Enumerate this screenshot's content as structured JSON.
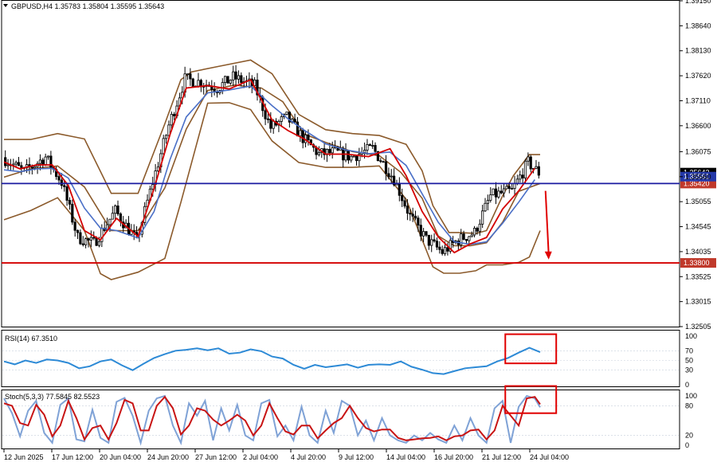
{
  "colors": {
    "background": "#ffffff",
    "grid": "#c8d0dc",
    "candle": "#000000",
    "bb": "#8b5a2b",
    "ema_fast": "#d40000",
    "ema_slow": "#4a6fc7",
    "support": "#d40000",
    "resistance": "#1a1aa0",
    "level_label_bg": "#c0392b",
    "rsi": "#2d8ad6",
    "stoch_main": "#7fa2d6",
    "stoch_signal": "#c81414",
    "highlight_box": "#e00000",
    "arrow": "#e00000"
  },
  "chart_data": [
    {
      "type": "line",
      "role": "main-price-panel",
      "title": "GBPUSD,H4  1.35783 1.35804 1.35595 1.35643",
      "ylim": [
        1.325,
        1.3915
      ],
      "y_ticks": [
        1.3915,
        1.3864,
        1.3813,
        1.3762,
        1.3711,
        1.366,
        1.3607,
        1.3556,
        1.3505,
        1.3454,
        1.3403,
        1.3352,
        1.3301,
        1.325
      ],
      "y_tick_labels": [
        "1.39150",
        "1.38640",
        "1.38130",
        "1.37620",
        "1.37110",
        "1.36600",
        "1.36075",
        "1.35560",
        "1.35055",
        "1.34545",
        "1.34035",
        "1.33525",
        "1.33015",
        "1.32505"
      ],
      "x_labels": [
        "12 Jun 2025",
        "17 Jun 12:00",
        "20 Jun 04:00",
        "24 Jun 20:00",
        "27 Jun 12:00",
        "2 Jul 04:00",
        "4 Jul 20:00",
        "9 Jul 12:00",
        "14 Jul 04:00",
        "16 Jul 20:00",
        "21 Jul 12:00",
        "24 Jul 04:00"
      ],
      "bar_count": 200,
      "series": [
        {
          "name": "Close",
          "x": [
            0,
            8,
            16,
            22,
            28,
            34,
            42,
            50,
            56,
            62,
            68,
            74,
            80,
            86,
            94,
            100,
            106,
            112,
            118,
            124,
            130,
            138,
            146,
            152,
            158,
            164,
            170,
            176,
            182,
            190,
            196,
            200
          ],
          "y": [
            1.3595,
            1.3566,
            1.3596,
            1.3545,
            1.3432,
            1.342,
            1.3486,
            1.3425,
            1.3545,
            1.3661,
            1.3755,
            1.3749,
            1.3737,
            1.3759,
            1.3741,
            1.3656,
            1.3677,
            1.3635,
            1.3602,
            1.3606,
            1.3596,
            1.3614,
            1.3552,
            1.3475,
            1.3428,
            1.3402,
            1.3427,
            1.3442,
            1.3517,
            1.3527,
            1.3585,
            1.3564
          ]
        },
        {
          "name": "Bollinger Upper",
          "x": [
            0,
            10,
            20,
            30,
            40,
            50,
            60,
            66,
            70,
            80,
            92,
            100,
            110,
            120,
            130,
            140,
            150,
            156,
            160,
            166,
            170,
            176,
            180,
            186,
            190,
            196,
            200
          ],
          "y": [
            1.3632,
            1.3632,
            1.3644,
            1.3633,
            1.3522,
            1.3522,
            1.3664,
            1.3754,
            1.377,
            1.3781,
            1.3794,
            1.3766,
            1.3683,
            1.3652,
            1.3644,
            1.364,
            1.3622,
            1.3568,
            1.3497,
            1.3442,
            1.3442,
            1.344,
            1.3446,
            1.3517,
            1.3558,
            1.3601,
            1.3601
          ]
        },
        {
          "name": "Bollinger Middle",
          "x": [
            0,
            10,
            20,
            30,
            40,
            50,
            60,
            68,
            76,
            86,
            96,
            104,
            112,
            120,
            130,
            140,
            148,
            156,
            162,
            168,
            174,
            180,
            186,
            192,
            200
          ],
          "y": [
            1.3555,
            1.3572,
            1.3578,
            1.3535,
            1.3446,
            1.3446,
            1.3533,
            1.3653,
            1.3732,
            1.3743,
            1.3737,
            1.3709,
            1.3643,
            1.3626,
            1.3607,
            1.3599,
            1.3565,
            1.3512,
            1.3435,
            1.3415,
            1.3415,
            1.3421,
            1.3463,
            1.3526,
            1.3542
          ]
        },
        {
          "name": "Bollinger Lower",
          "x": [
            0,
            10,
            20,
            30,
            36,
            40,
            50,
            60,
            66,
            76,
            84,
            92,
            100,
            110,
            120,
            130,
            140,
            150,
            160,
            164,
            170,
            176,
            180,
            186,
            192,
            196,
            200
          ],
          "y": [
            1.3468,
            1.3487,
            1.3513,
            1.3446,
            1.3358,
            1.3346,
            1.3361,
            1.3389,
            1.3504,
            1.3706,
            1.3707,
            1.3693,
            1.3629,
            1.3585,
            1.3575,
            1.3575,
            1.3578,
            1.351,
            1.3372,
            1.3359,
            1.3359,
            1.3364,
            1.3376,
            1.3376,
            1.3381,
            1.3392,
            1.3446
          ]
        },
        {
          "name": "EMA fast",
          "x": [
            0,
            6,
            12,
            18,
            24,
            30,
            36,
            42,
            50,
            56,
            62,
            68,
            76,
            84,
            92,
            100,
            106,
            112,
            120,
            128,
            136,
            144,
            150,
            156,
            162,
            168,
            174,
            180,
            186,
            192,
            198
          ],
          "y": [
            1.3586,
            1.3572,
            1.358,
            1.358,
            1.3538,
            1.3446,
            1.3427,
            1.3471,
            1.3434,
            1.3532,
            1.3643,
            1.3737,
            1.3742,
            1.3735,
            1.3754,
            1.3672,
            1.365,
            1.3633,
            1.3602,
            1.3602,
            1.3597,
            1.3613,
            1.3558,
            1.3485,
            1.3433,
            1.3401,
            1.3419,
            1.3432,
            1.349,
            1.3527,
            1.3573
          ]
        },
        {
          "name": "EMA slow",
          "x": [
            0,
            6,
            12,
            18,
            24,
            30,
            36,
            42,
            50,
            56,
            62,
            68,
            76,
            84,
            92,
            100,
            106,
            112,
            120,
            128,
            136,
            144,
            150,
            156,
            162,
            168,
            174,
            180,
            186,
            192,
            198
          ],
          "y": [
            1.357,
            1.3566,
            1.3572,
            1.3573,
            1.3553,
            1.3492,
            1.3451,
            1.3446,
            1.3431,
            1.3485,
            1.3592,
            1.3678,
            1.3727,
            1.3733,
            1.3741,
            1.3701,
            1.3674,
            1.3651,
            1.3623,
            1.361,
            1.3603,
            1.3606,
            1.3579,
            1.3521,
            1.3463,
            1.3423,
            1.3418,
            1.3423,
            1.3461,
            1.3504,
            1.355
          ]
        }
      ],
      "levels": [
        {
          "name": "resistance",
          "value": 1.3542,
          "label": "1.35420"
        },
        {
          "name": "support",
          "value": 1.338,
          "label": "1.33800"
        }
      ],
      "price_tags": [
        {
          "value": 1.35643,
          "label": "1.35643"
        },
        {
          "value": 1.35561,
          "label": "1.35561"
        }
      ],
      "arrow": {
        "from_bar": 202,
        "from_value": 1.3527,
        "to_value": 1.3387
      }
    },
    {
      "type": "line",
      "role": "rsi-panel",
      "title": "RSI(14) 67.3510",
      "ylim": [
        0,
        100
      ],
      "y_ticks": [
        100,
        70,
        50,
        30,
        0
      ],
      "x": [
        0,
        4,
        8,
        12,
        16,
        20,
        24,
        28,
        32,
        36,
        40,
        44,
        48,
        52,
        56,
        60,
        64,
        68,
        72,
        76,
        80,
        84,
        88,
        92,
        96,
        100,
        104,
        108,
        112,
        116,
        120,
        124,
        128,
        132,
        136,
        140,
        144,
        148,
        152,
        156,
        160,
        164,
        168,
        172,
        176,
        180,
        184,
        188,
        192,
        196,
        200
      ],
      "values": [
        48,
        42,
        50,
        45,
        52,
        50,
        45,
        34,
        38,
        48,
        52,
        40,
        30,
        43,
        55,
        63,
        70,
        72,
        75,
        71,
        75,
        64,
        66,
        73,
        69,
        58,
        54,
        41,
        33,
        41,
        36,
        39,
        42,
        35,
        41,
        42,
        41,
        48,
        37,
        31,
        24,
        22,
        28,
        34,
        36,
        38,
        48,
        55,
        66,
        76,
        67
      ],
      "highlight": {
        "from_bar": 187,
        "to_bar": 206,
        "from_value": 44,
        "to_value": 104
      }
    },
    {
      "type": "line",
      "role": "stochastic-panel",
      "title": "Stoch(5,3,3) 77.5845 82.5523",
      "ylim": [
        0,
        100
      ],
      "y_ticks": [
        100,
        80,
        20,
        0
      ],
      "series": [
        {
          "name": "Stoch(5,3,3)",
          "x": [
            0,
            3,
            6,
            9,
            12,
            15,
            18,
            21,
            24,
            27,
            30,
            33,
            36,
            39,
            42,
            45,
            48,
            51,
            54,
            57,
            60,
            63,
            66,
            69,
            72,
            75,
            78,
            81,
            84,
            87,
            90,
            93,
            96,
            99,
            102,
            105,
            108,
            111,
            114,
            117,
            120,
            123,
            126,
            129,
            132,
            135,
            138,
            141,
            144,
            147,
            150,
            153,
            156,
            159,
            162,
            165,
            168,
            171,
            174,
            177,
            180,
            183,
            186,
            189,
            192,
            195,
            198,
            200
          ],
          "values": [
            95,
            65,
            18,
            70,
            90,
            25,
            5,
            82,
            95,
            12,
            8,
            72,
            15,
            5,
            88,
            96,
            60,
            5,
            70,
            95,
            100,
            40,
            5,
            85,
            60,
            90,
            10,
            75,
            30,
            82,
            20,
            10,
            85,
            92,
            18,
            40,
            10,
            78,
            20,
            5,
            70,
            25,
            90,
            80,
            20,
            50,
            10,
            55,
            20,
            10,
            5,
            20,
            10,
            25,
            12,
            5,
            40,
            10,
            55,
            20,
            5,
            75,
            90,
            5,
            78,
            100,
            95,
            77
          ]
        },
        {
          "name": "Signal",
          "x": [
            0,
            3,
            6,
            9,
            12,
            15,
            18,
            21,
            24,
            27,
            30,
            33,
            36,
            39,
            42,
            45,
            48,
            51,
            54,
            57,
            60,
            63,
            66,
            69,
            72,
            75,
            78,
            81,
            84,
            87,
            90,
            93,
            96,
            99,
            102,
            105,
            108,
            111,
            114,
            117,
            120,
            123,
            126,
            129,
            132,
            135,
            138,
            141,
            144,
            147,
            150,
            153,
            156,
            159,
            162,
            165,
            168,
            171,
            174,
            177,
            180,
            183,
            186,
            189,
            192,
            195,
            198,
            200
          ],
          "values": [
            85,
            80,
            45,
            40,
            82,
            62,
            18,
            40,
            90,
            55,
            12,
            35,
            40,
            12,
            45,
            92,
            85,
            30,
            30,
            80,
            98,
            75,
            22,
            40,
            75,
            70,
            52,
            40,
            50,
            62,
            50,
            20,
            40,
            85,
            55,
            28,
            22,
            40,
            40,
            14,
            30,
            45,
            55,
            80,
            55,
            35,
            28,
            32,
            32,
            15,
            10,
            12,
            14,
            15,
            18,
            10,
            18,
            20,
            30,
            32,
            12,
            30,
            80,
            60,
            40,
            95,
            98,
            83
          ]
        }
      ],
      "highlight": {
        "from_bar": 187,
        "to_bar": 206,
        "from_value": 65,
        "to_value": 120
      }
    }
  ]
}
